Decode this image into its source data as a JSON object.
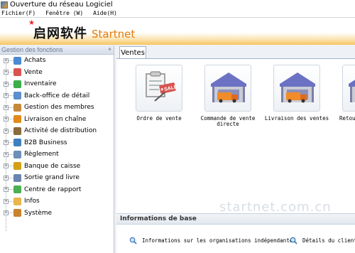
{
  "window": {
    "title": "Ouverture du réseau Logiciel"
  },
  "menu": [
    "Fichier(F)",
    "Fenêtre (W)",
    "Aide(H)"
  ],
  "banner": {
    "logo_cn": "启网软件",
    "logo_en": "Startnet"
  },
  "sidebar": {
    "title": "Gestion des fonctions",
    "items": [
      {
        "label": "Achats",
        "icon": "cart-icon",
        "color": "#4a8ad4"
      },
      {
        "label": "Vente",
        "icon": "sale-icon",
        "color": "#d9534f"
      },
      {
        "label": "Inventaire",
        "icon": "inventory-icon",
        "color": "#3cae4a"
      },
      {
        "label": "Back-office de détail",
        "icon": "shopping-cart-icon",
        "color": "#5b8fd0"
      },
      {
        "label": "Gestion des membres",
        "icon": "members-icon",
        "color": "#c48a3a"
      },
      {
        "label": "Livraison en chaîne",
        "icon": "truck-icon",
        "color": "#e28b1c"
      },
      {
        "label": "Activité de distribution",
        "icon": "distribution-icon",
        "color": "#8a6a3a"
      },
      {
        "label": "B2B Business",
        "icon": "b2b-icon",
        "color": "#3f7fc0"
      },
      {
        "label": "Règlement",
        "icon": "settlement-icon",
        "color": "#6d8fb8"
      },
      {
        "label": "Banque de caisse",
        "icon": "bank-icon",
        "color": "#d4a017"
      },
      {
        "label": "Sortie grand livre",
        "icon": "ledger-icon",
        "color": "#6a86b0"
      },
      {
        "label": "Centre de rapport",
        "icon": "report-icon",
        "color": "#4caf50"
      },
      {
        "label": "Infos",
        "icon": "folder-icon",
        "color": "#e8b64a"
      },
      {
        "label": "Système",
        "icon": "system-icon",
        "color": "#c9832a"
      }
    ]
  },
  "content": {
    "tab": "Ventes",
    "tiles": [
      {
        "label": "Ordre de vente",
        "icon": "sales-order-icon"
      },
      {
        "label": "Commande de vente directe",
        "icon": "warehouse-truck-icon"
      },
      {
        "label": "Livraison des ventes",
        "icon": "warehouse-truck-icon"
      },
      {
        "label": "Retou",
        "icon": "warehouse-truck-icon"
      }
    ],
    "watermark": "startnet.com.cn",
    "info": {
      "title": "Informations de base",
      "links": [
        "Informations sur les organisations indépendantes",
        "Détails du client"
      ]
    }
  }
}
